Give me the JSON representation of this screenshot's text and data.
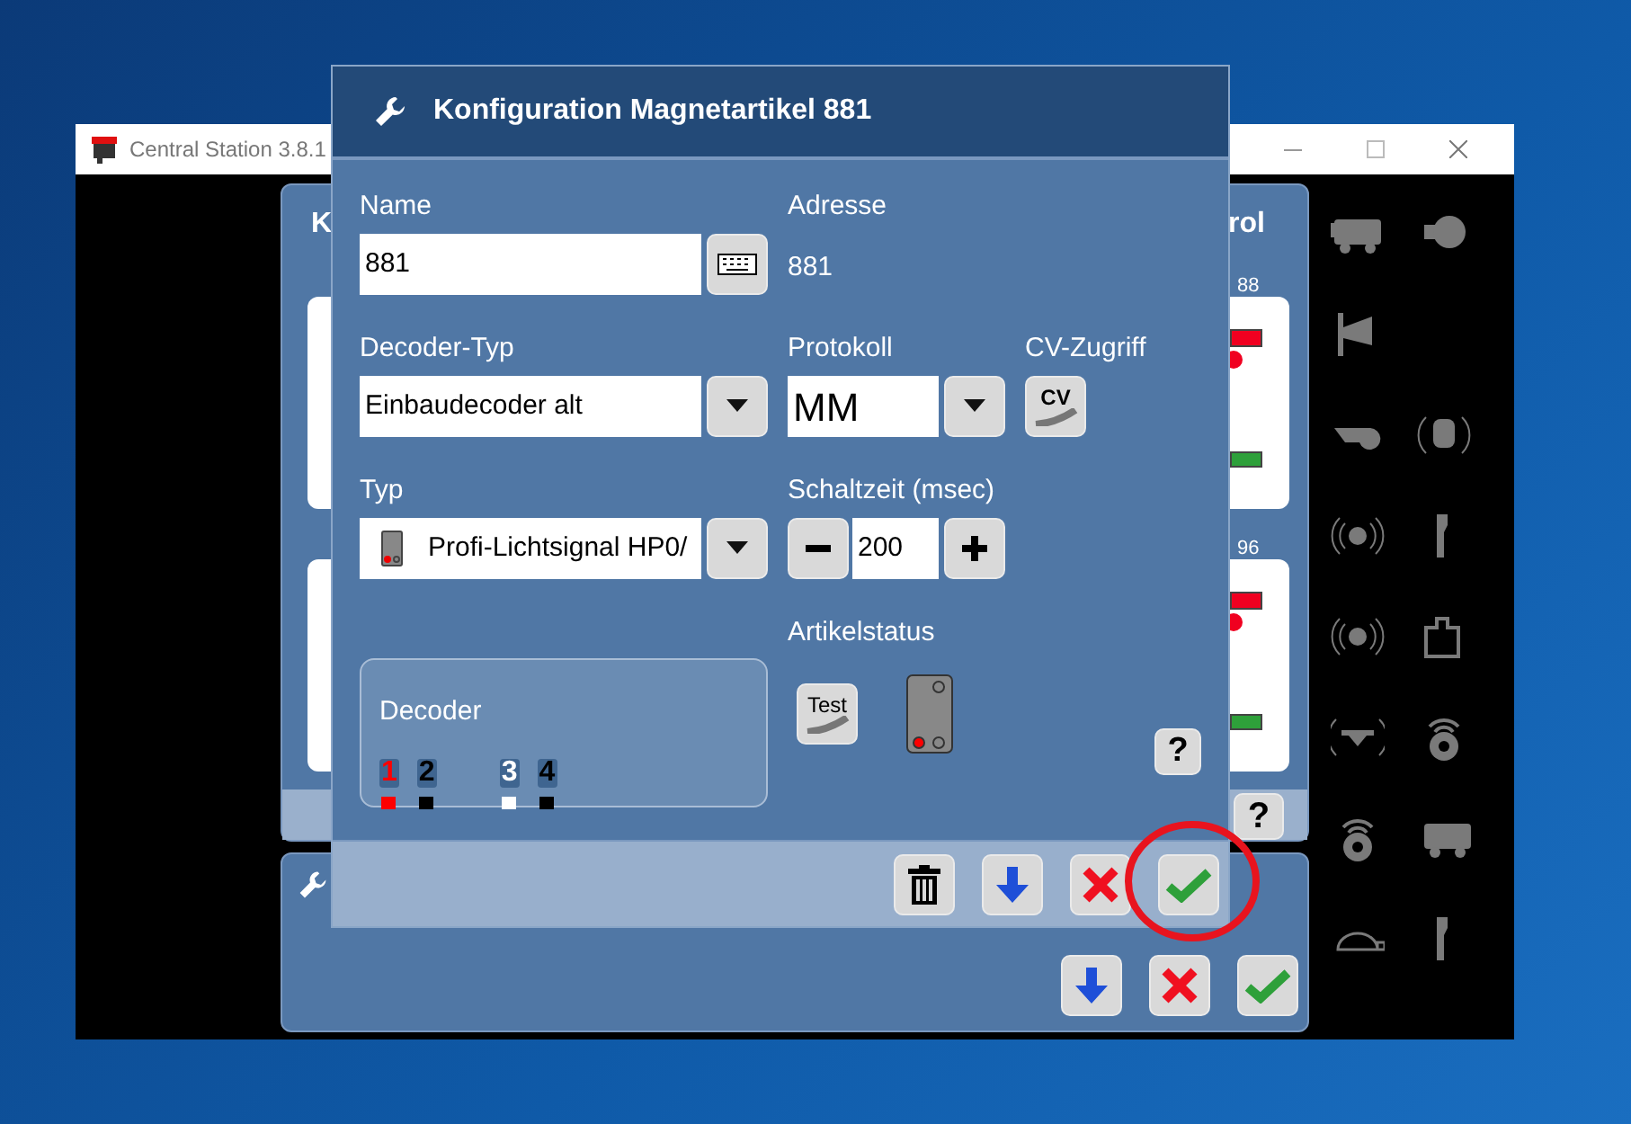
{
  "app_window": {
    "title": "Central Station 3.8.1"
  },
  "background_panel": {
    "title_left": "K",
    "title_right": "rol",
    "cards": [
      {
        "label": "88"
      },
      {
        "label": "96"
      }
    ]
  },
  "dialog": {
    "title": "Konfiguration Magnetartikel 881",
    "name": {
      "label": "Name",
      "value": "881"
    },
    "address": {
      "label": "Adresse",
      "value": "881"
    },
    "decoder_type": {
      "label": "Decoder-Typ",
      "value": "Einbaudecoder alt"
    },
    "protocol": {
      "label": "Protokoll",
      "value": "MM"
    },
    "cv_access": {
      "label": "CV-Zugriff",
      "button": "CV"
    },
    "type": {
      "label": "Typ",
      "value": "Profi-Lichtsignal HP0/"
    },
    "switch_time": {
      "label": "Schaltzeit (msec)",
      "value": "200"
    },
    "article_status": {
      "label": "Artikelstatus",
      "test_button": "Test",
      "help": "?"
    },
    "decoder": {
      "label": "Decoder",
      "outputs": [
        {
          "label": "1",
          "color": "#ff0000"
        },
        {
          "label": "2",
          "color": "#000000"
        },
        {
          "label": "3",
          "color": "#ffffff"
        },
        {
          "label": "4",
          "color": "#000000"
        }
      ]
    },
    "footer_buttons": [
      {
        "kind": "delete",
        "circled": false
      },
      {
        "kind": "down",
        "circled": false
      },
      {
        "kind": "cancel",
        "circled": false
      },
      {
        "kind": "confirm",
        "circled": true
      }
    ]
  },
  "background_help": "?",
  "lower_panel_buttons": [
    {
      "kind": "down"
    },
    {
      "kind": "cancel"
    },
    {
      "kind": "confirm"
    }
  ]
}
